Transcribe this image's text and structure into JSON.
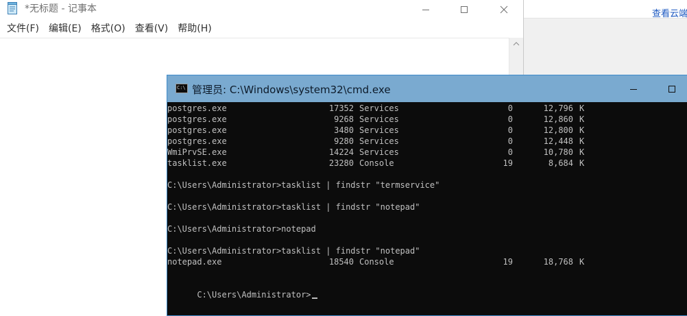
{
  "background_app": {
    "link_text": "查看云端"
  },
  "notepad": {
    "title": "*无标题 - 记事本",
    "menu": [
      "文件(F)",
      "编辑(E)",
      "格式(O)",
      "查看(V)",
      "帮助(H)"
    ],
    "icon": "notepad-icon"
  },
  "cmd": {
    "title": "管理员: C:\\Windows\\system32\\cmd.exe",
    "icon_text": "C:\\",
    "colors": {
      "titlebar": "#7aaad0",
      "background": "#0c0c0c",
      "text": "#c0c0c0"
    },
    "task_rows": [
      {
        "image": "postgres.exe",
        "pid": "17352",
        "session": "Services",
        "session_no": "0",
        "mem": "12,796",
        "unit": "K"
      },
      {
        "image": "postgres.exe",
        "pid": "9268",
        "session": "Services",
        "session_no": "0",
        "mem": "12,860",
        "unit": "K"
      },
      {
        "image": "postgres.exe",
        "pid": "3480",
        "session": "Services",
        "session_no": "0",
        "mem": "12,800",
        "unit": "K"
      },
      {
        "image": "postgres.exe",
        "pid": "9280",
        "session": "Services",
        "session_no": "0",
        "mem": "12,448",
        "unit": "K"
      },
      {
        "image": "WmiPrvSE.exe",
        "pid": "14224",
        "session": "Services",
        "session_no": "0",
        "mem": "10,780",
        "unit": "K"
      },
      {
        "image": "tasklist.exe",
        "pid": "23280",
        "session": "Console",
        "session_no": "19",
        "mem": "8,684",
        "unit": "K"
      }
    ],
    "commands": [
      "C:\\Users\\Administrator>tasklist | findstr \"termservice\"",
      "C:\\Users\\Administrator>tasklist | findstr \"notepad\"",
      "C:\\Users\\Administrator>notepad",
      "C:\\Users\\Administrator>tasklist | findstr \"notepad\""
    ],
    "result_row": {
      "image": "notepad.exe",
      "pid": "18540",
      "session": "Console",
      "session_no": "19",
      "mem": "18,768",
      "unit": "K"
    },
    "prompt": "C:\\Users\\Administrator>"
  }
}
